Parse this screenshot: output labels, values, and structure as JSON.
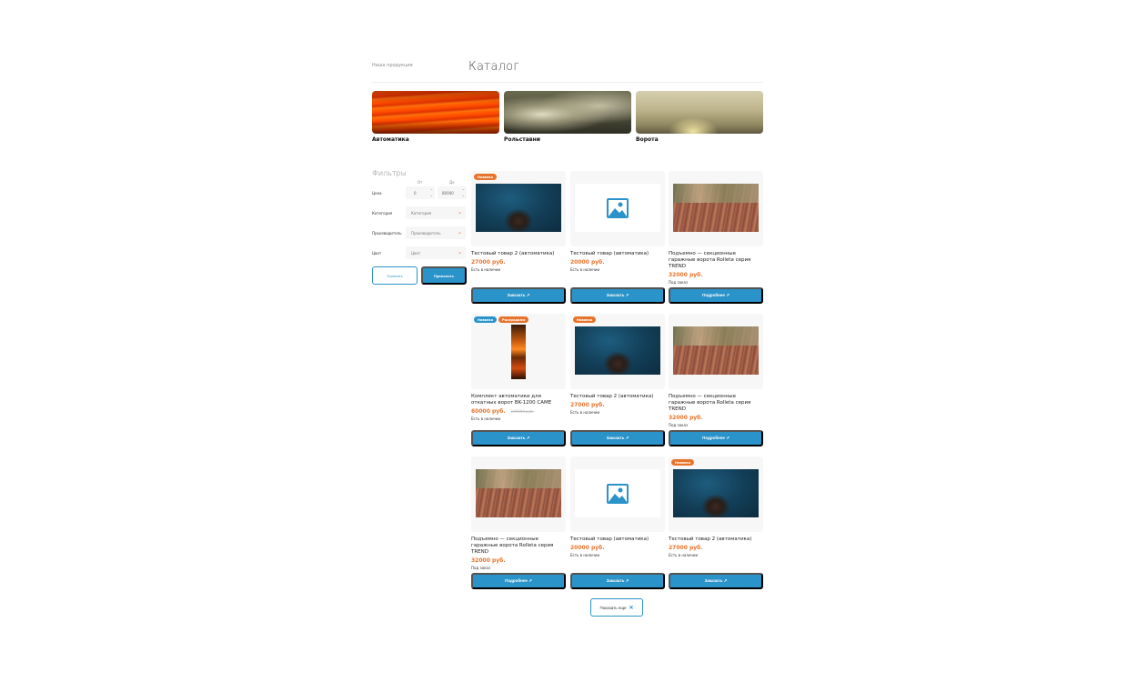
{
  "breadcrumb": "Наша продукция",
  "page_title": "Каталог",
  "categories": [
    {
      "label": "Автоматика"
    },
    {
      "label": "Рольставни"
    },
    {
      "label": "Ворота"
    }
  ],
  "filters": {
    "title": "Фильтры",
    "from_label": "От",
    "to_label": "До",
    "price_label": "Цена",
    "price_min": "0",
    "price_max": "80000",
    "category_label": "Категория",
    "category_placeholder": "Категория",
    "manufacturer_label": "Производитель",
    "manufacturer_placeholder": "Производитель",
    "color_label": "Цвет",
    "color_placeholder": "Цвет",
    "reset_label": "Очистить",
    "apply_label": "Применить"
  },
  "products": [
    {
      "name": "Тестовый товар 2 (автоматика)",
      "price": "27000 руб.",
      "old_price": "",
      "stock": "Есть в наличии",
      "button": "Заказать ↗",
      "badges": [
        "Новинка"
      ],
      "image": "sea"
    },
    {
      "name": "Тестовый товар (автоматика)",
      "price": "20000 руб.",
      "old_price": "",
      "stock": "Есть в наличии",
      "button": "Заказать ↗",
      "badges": [],
      "image": "placeholder"
    },
    {
      "name": "Подъемно — секционные гаражные ворота Rolleta серия TREND",
      "price": "32000 руб.",
      "old_price": "",
      "stock": "Под заказ",
      "button": "Подробнее ↗",
      "badges": [],
      "image": "leaves"
    },
    {
      "name": "Комплект автоматики для откатных ворот BK-1200 CAME",
      "price": "60000 руб.",
      "old_price": "100000 руб.",
      "stock": "Есть в наличии",
      "button": "Заказать ↗",
      "badges": [
        "Новинка",
        "Распродажа"
      ],
      "image": "strip"
    },
    {
      "name": "Тестовый товар 2 (автоматика)",
      "price": "27000 руб.",
      "old_price": "",
      "stock": "Есть в наличии",
      "button": "Заказать ↗",
      "badges": [
        "Новинка"
      ],
      "image": "sea"
    },
    {
      "name": "Подъемно — секционные гаражные ворота Rolleta серия TREND",
      "price": "32000 руб.",
      "old_price": "",
      "stock": "Под заказ",
      "button": "Подробнее ↗",
      "badges": [],
      "image": "leaves"
    },
    {
      "name": "Подъемно — секционные гаражные ворота Rolleta серия TREND",
      "price": "32000 руб.",
      "old_price": "",
      "stock": "Под заказ",
      "button": "Подробнее ↗",
      "badges": [],
      "image": "leaves"
    },
    {
      "name": "Тестовый товар (автоматика)",
      "price": "20000 руб.",
      "old_price": "",
      "stock": "Есть в наличии",
      "button": "Заказать ↗",
      "badges": [],
      "image": "placeholder"
    },
    {
      "name": "Тестовый товар 2 (автоматика)",
      "price": "27000 руб.",
      "old_price": "",
      "stock": "Есть в наличии",
      "button": "Заказать ↗",
      "badges": [
        "Новинка"
      ],
      "image": "sea"
    }
  ],
  "show_more": "Показать еще",
  "colors": {
    "accent_blue": "#2a93c9",
    "accent_orange": "#e8742c"
  }
}
